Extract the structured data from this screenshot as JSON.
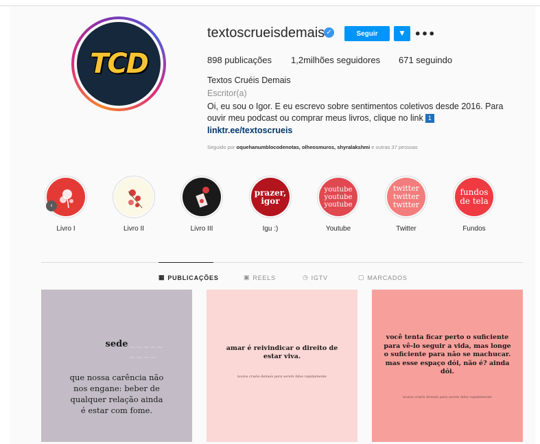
{
  "profile": {
    "username": "textoscrueisdemais",
    "avatar_text": "TCD",
    "follow_label": "Seguir",
    "more_label": "•••",
    "stats": {
      "posts": "898 publicações",
      "followers": "1,2milhões seguidores",
      "following": "671 seguindo"
    },
    "full_name": "Textos Cruéis Demais",
    "category": "Escritor(a)",
    "bio_line1": "Oi, eu sou o Igor. E eu escrevo sobre sentimentos coletivos desde 2016. Para",
    "bio_line2": "ouvir meu podcast ou comprar meus livros, clique no link",
    "bio_icon": "1",
    "link": "linktr.ee/textoscrueis",
    "followed_by_prefix": "Seguido por",
    "followed_by_names": "oquehanumblocodenotas, olheosmuros, shyralakshmi",
    "followed_by_suffix": "e outras 37 pessoas"
  },
  "highlights": [
    {
      "label": "Livro I",
      "cover_text": "",
      "color": "#e43a36"
    },
    {
      "label": "Livro II",
      "cover_text": "",
      "color": "#fbf8e6"
    },
    {
      "label": "Livro III",
      "cover_text": "",
      "color": "#1a1a1a"
    },
    {
      "label": "Igu :)",
      "cover_text": "prazer, igor",
      "color": "#b3141d"
    },
    {
      "label": "Youtube",
      "cover_text": "youtube youtube youtube",
      "color": "#e04950"
    },
    {
      "label": "Twitter",
      "cover_text": "twitter twitter twitter",
      "color": "#f37c7c"
    },
    {
      "label": "Fundos",
      "cover_text": "fundos de tela",
      "color": "#ef3a42"
    }
  ],
  "tabs": [
    {
      "label": "PUBLICAÇÕES",
      "icon": "grid-icon",
      "active": true
    },
    {
      "label": "REELS",
      "icon": "reels-icon",
      "active": false
    },
    {
      "label": "IGTV",
      "icon": "igtv-icon",
      "active": false
    },
    {
      "label": "MARCADOS",
      "icon": "tagged-icon",
      "active": false
    }
  ],
  "posts": {
    "p1_title": "sede",
    "p1_body": "que nossa carência não nos engane: beber de qualquer relação ainda é estar com fome.",
    "p2_body": "amar é reivindicar o direito de estar viva.",
    "p2_sig": "textos cruéis demais para serem lidos rapidamente",
    "p3_body": "você tenta ficar perto o suficiente para vê-lo seguir a vida, mas longe o suficiente para não se machucar. mas esse espaço dói, não é? ainda dói.",
    "p3_sig": "textos cruéis demais para serem lidos rapidamente"
  }
}
